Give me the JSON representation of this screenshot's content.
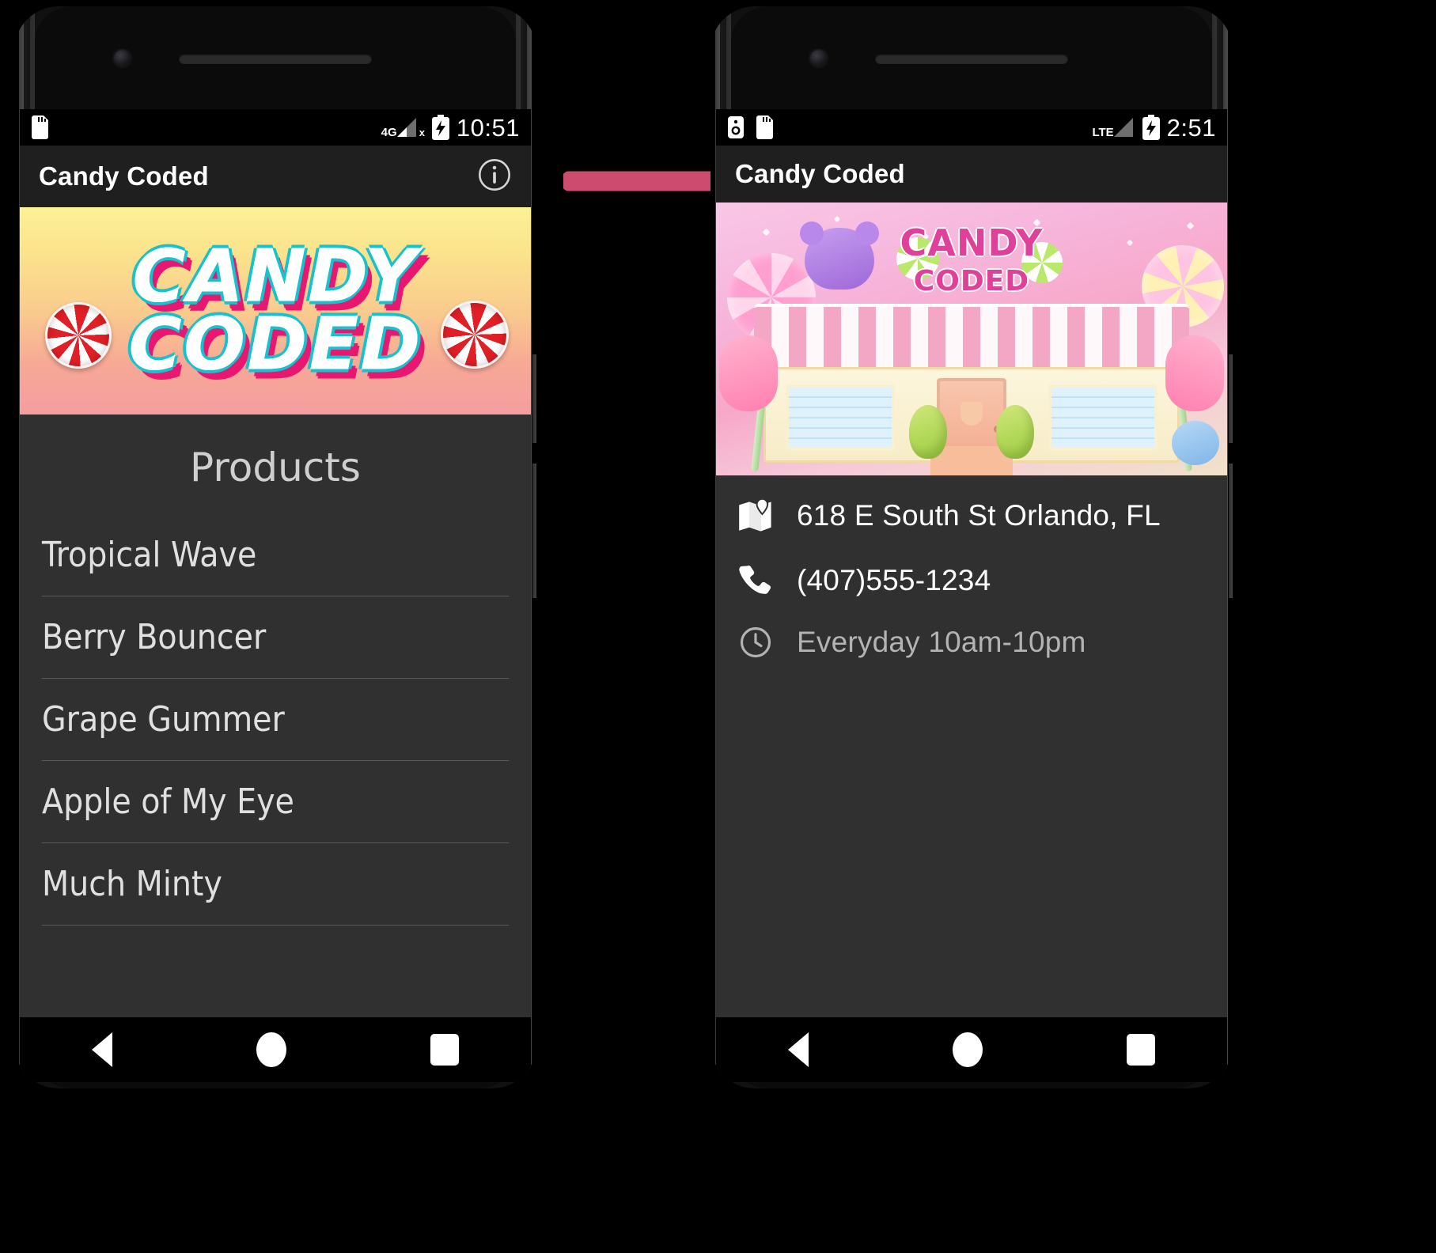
{
  "figure": {
    "arrow_color": "#cc4b6f",
    "background": "#000000"
  },
  "left_phone": {
    "name": "products-screen",
    "status_bar": {
      "time": "10:51",
      "network_label": "4G",
      "icons": [
        "sd-card-icon",
        "signal-4g-icon",
        "signal-no-service-x",
        "battery-charging-icon"
      ]
    },
    "app_bar": {
      "title": "Candy Coded",
      "action_icon": "info-icon"
    },
    "banner": {
      "line1": "CANDY",
      "line2": "CODED",
      "decorations": [
        "peppermint-candy-left",
        "peppermint-candy-right"
      ],
      "gradient_start": "#fbf196",
      "gradient_end": "#f59ea0"
    },
    "section_title": "Products",
    "products": [
      "Tropical Wave",
      "Berry Bouncer",
      "Grape Gummer",
      "Apple of My Eye",
      "Much Minty"
    ],
    "nav_bar": [
      "back-icon",
      "home-icon",
      "recents-icon"
    ]
  },
  "right_phone": {
    "name": "about-screen",
    "status_bar": {
      "time": "2:51",
      "network_label": "LTE",
      "icons": [
        "usb-debug-icon",
        "sd-card-icon",
        "signal-lte-icon",
        "battery-charging-icon"
      ]
    },
    "app_bar": {
      "title": "Candy Coded"
    },
    "banner": {
      "sign_line1": "CANDY",
      "sign_line2": "CODED",
      "description": "candy-shop-storefront-illustration"
    },
    "info_rows": [
      {
        "icon": "map-icon",
        "text": "618 E South St Orlando, FL",
        "muted": false
      },
      {
        "icon": "phone-icon",
        "text": "(407)555-1234",
        "muted": false
      },
      {
        "icon": "clock-icon",
        "text": "Everyday 10am-10pm",
        "muted": true
      }
    ],
    "nav_bar": [
      "back-icon",
      "home-icon",
      "recents-icon"
    ]
  }
}
